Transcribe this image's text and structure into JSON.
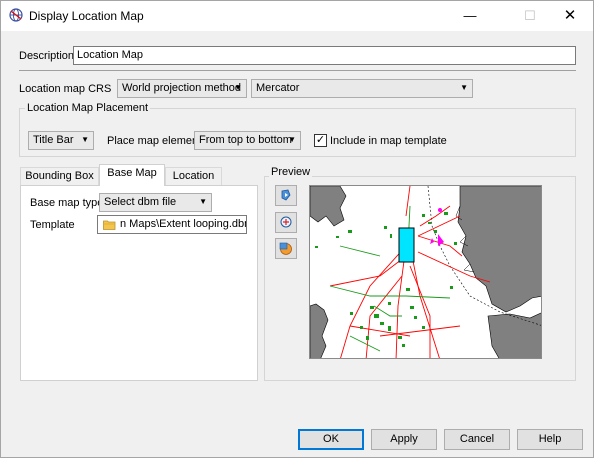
{
  "window": {
    "title": "Display Location Map",
    "minimize": "—",
    "maximize": "☐",
    "close": "✕"
  },
  "description": {
    "label": "Description",
    "value": "Location Map"
  },
  "crs": {
    "label": "Location map CRS",
    "method": "World projection method",
    "projection": "Mercator"
  },
  "placement": {
    "title": "Location Map Placement",
    "position": "Title Bar",
    "place_label": "Place map element",
    "order": "From top to bottom",
    "include_label": "Include in map template",
    "include_checked": true
  },
  "tabs": [
    {
      "label": "Bounding Box",
      "active": false
    },
    {
      "label": "Base Map",
      "active": true
    },
    {
      "label": "Location",
      "active": false
    }
  ],
  "base_map": {
    "type_label": "Base map type",
    "type_value": "Select dbm file",
    "template_label": "Template",
    "template_value": "n Maps\\Extent looping.dbm"
  },
  "preview": {
    "title": "Preview",
    "icons": [
      "refresh-map-icon",
      "zoom-extent-icon",
      "frame-color-icon"
    ]
  },
  "buttons": {
    "ok": "OK",
    "apply": "Apply",
    "cancel": "Cancel",
    "help": "Help"
  },
  "colors": {
    "selection_box": "#00e5ff",
    "pipelines": "#ff0000",
    "fields": "#1a9a1a",
    "land": "#808080",
    "accent": "#0078d7"
  }
}
